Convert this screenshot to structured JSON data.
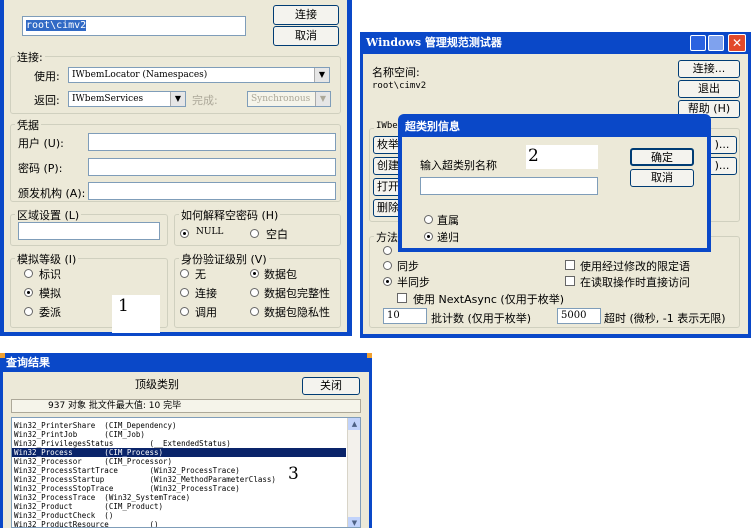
{
  "connect_dialog": {
    "namespace_value": "root\\cimv2",
    "connect_button": "连接",
    "cancel_button": "取消",
    "connection_group": "连接:",
    "use_label": "使用:",
    "use_value": "IWbemLocator (Namespaces)",
    "return_label": "返回:",
    "return_value": "IWbemServices",
    "complete_label": "完成:",
    "complete_value": "Synchronous",
    "credentials_group": "凭据",
    "user_label": "用户 (U):",
    "password_label": "密码 (P):",
    "authority_label": "颁发机构 (A):",
    "locale_group": "区域设置 (L)",
    "null_password_group": "如何解释空密码 (H)",
    "null_option": "NULL",
    "empty_option": "空白",
    "impersonation_group": "模拟等级 (I)",
    "impersonation_options": [
      "标识",
      "模拟",
      "委派"
    ],
    "auth_group": "身份验证级别 (V)",
    "auth_options_left": [
      "无",
      "连接",
      "调用"
    ],
    "auth_options_right": [
      "数据包",
      "数据包完整性",
      "数据包隐私性"
    ],
    "annotation": "1"
  },
  "wbemtest": {
    "title": "Windows 管理规范测试器",
    "namespace_label": "名称空间:",
    "namespace_value": "root\\cimv2",
    "connect_button": "连接...",
    "exit_button": "退出",
    "help_button": "帮助 (H)",
    "iwbem_group": "IWbem",
    "side_buttons": [
      "枚举",
      "创建",
      "打开",
      "删除"
    ],
    "method_group": "方法调",
    "sync_option": "同步",
    "semisync_option": "半同步",
    "use_nextasync": "使用 NextAsync (仅用于枚举)",
    "batch_value": "10",
    "batch_label": "批计数 (仅用于枚举)",
    "timeout_value": "5000",
    "timeout_label": "超时 (微秒, -1 表示无限)",
    "use_amended": "使用经过修改的限定语",
    "direct_read": "在读取操作时直接访问",
    "right_buttons": [
      ")...",
      ")..."
    ]
  },
  "superclass_dialog": {
    "title": "超类别信息",
    "prompt": "输入超类别名称",
    "annotation": "2",
    "ok_button": "确定",
    "cancel_button": "取消",
    "option_direct": "直属",
    "option_recursive": "递归"
  },
  "query_result": {
    "title": "查询结果",
    "header": "顶级类别",
    "close_button": "关闭",
    "status": "937 对象 批文件最大值: 10 完毕",
    "annotation": "3",
    "rows": [
      "Win32_PrinterShare  (CIM_Dependency)",
      "Win32_PrintJob      (CIM_Job)",
      "Win32_PrivilegesStatus        (__ExtendedStatus)",
      "Win32_Process       (CIM_Process)",
      "Win32_Processor     (CIM_Processor)",
      "Win32_ProcessStartTrace       (Win32_ProcessTrace)",
      "Win32_ProcessStartup          (Win32_MethodParameterClass)",
      "Win32_ProcessStopTrace        (Win32_ProcessTrace)",
      "Win32_ProcessTrace  (Win32_SystemTrace)",
      "Win32_Product       (CIM_Product)",
      "Win32_ProductCheck  ()",
      "Win32_ProductResource         ()"
    ],
    "selected_row": 3
  }
}
